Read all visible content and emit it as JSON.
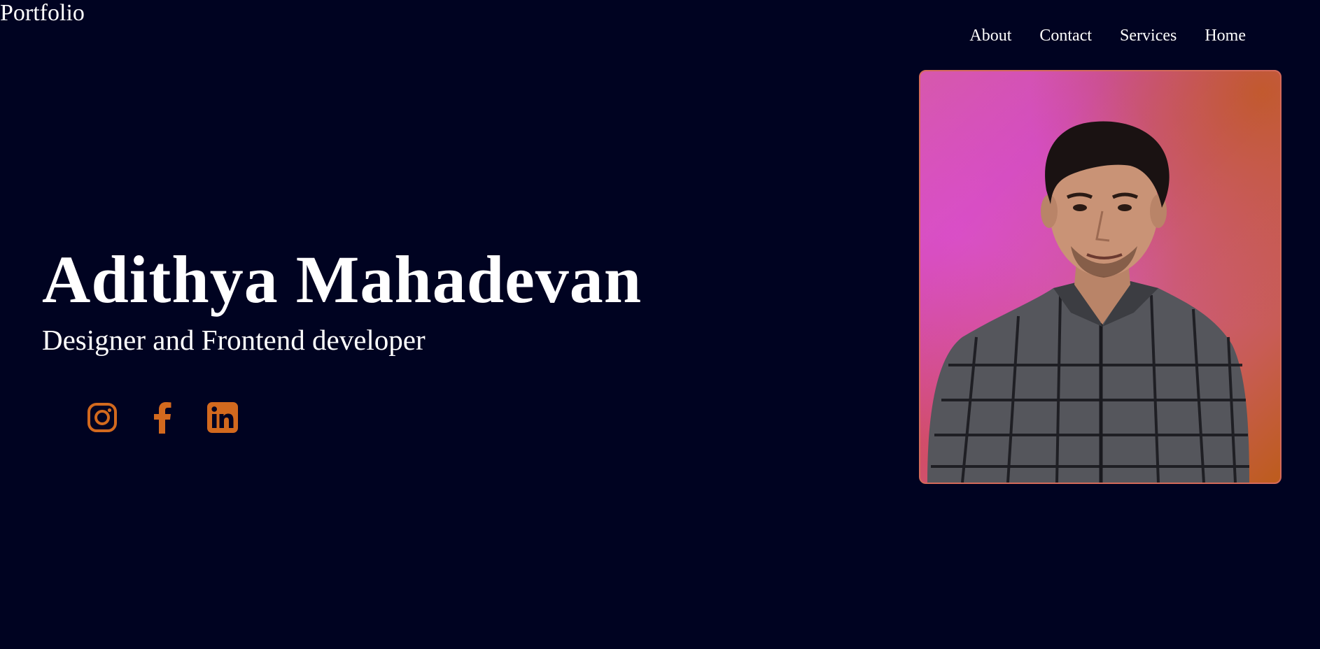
{
  "header": {
    "logo": "Portfolio",
    "nav": [
      {
        "label": "About"
      },
      {
        "label": "Contact"
      },
      {
        "label": "Services"
      },
      {
        "label": "Home"
      }
    ]
  },
  "hero": {
    "name": "Adithya Mahadevan",
    "role": "Designer and Frontend developer"
  },
  "socials": [
    {
      "icon": "instagram-icon"
    },
    {
      "icon": "facebook-icon"
    },
    {
      "icon": "linkedin-icon"
    }
  ],
  "colors": {
    "background": "#000321",
    "text": "#ffffff",
    "accent": "#d2691e",
    "photo_border": "#d46a5a"
  }
}
